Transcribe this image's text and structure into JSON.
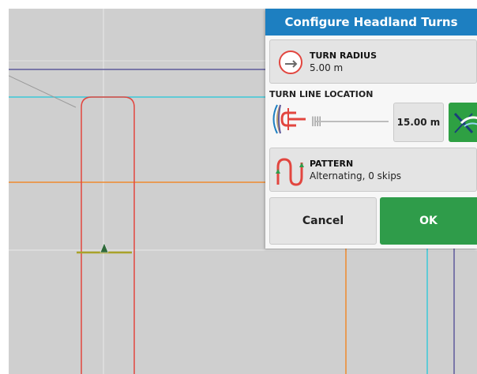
{
  "panel": {
    "title": "Configure Headland Turns",
    "turn_radius": {
      "label": "TURN RADIUS",
      "value": "5.00 m",
      "icon": "turn-radius-icon"
    },
    "turn_line_location": {
      "label": "TURN LINE LOCATION",
      "value": "15.00 m",
      "icon": "turn-line-icon",
      "toggle_icon": "turn-line-toggle-icon"
    },
    "pattern": {
      "label": "PATTERN",
      "value": "Alternating, 0 skips",
      "icon": "pattern-icon"
    },
    "cancel_label": "Cancel",
    "ok_label": "OK"
  },
  "colors": {
    "header": "#1d7fc1",
    "ok": "#2f9c4a",
    "map_bg": "#cfcfcf",
    "boundary": "#e2463f",
    "guidance_purple": "#5f5a9c",
    "guidance_cyan": "#3cc9d9",
    "guidance_orange": "#ef8a2e",
    "implement": "#a9a22a"
  }
}
